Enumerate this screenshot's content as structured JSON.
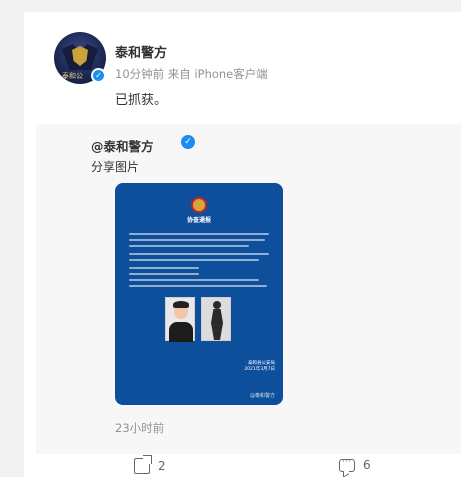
{
  "post": {
    "author": "泰和警方",
    "avatar_label": "泰和公",
    "meta": "10分钟前 来自 iPhone客户端",
    "text": "已抓获。",
    "verified_icon": "verified-badge-icon"
  },
  "repost": {
    "author": "@泰和警方",
    "text": "分享图片",
    "time": "23小时前",
    "image": {
      "title": "协查通报",
      "footer": "泰和县公安局",
      "footer_date": "2021年3月7日",
      "watermark": "@泰和警方"
    }
  },
  "actions": {
    "share_count": "2",
    "comment_count": "6"
  },
  "colors": {
    "accent_blue": "#1d8df0",
    "poster_blue": "#0e4f9c"
  }
}
